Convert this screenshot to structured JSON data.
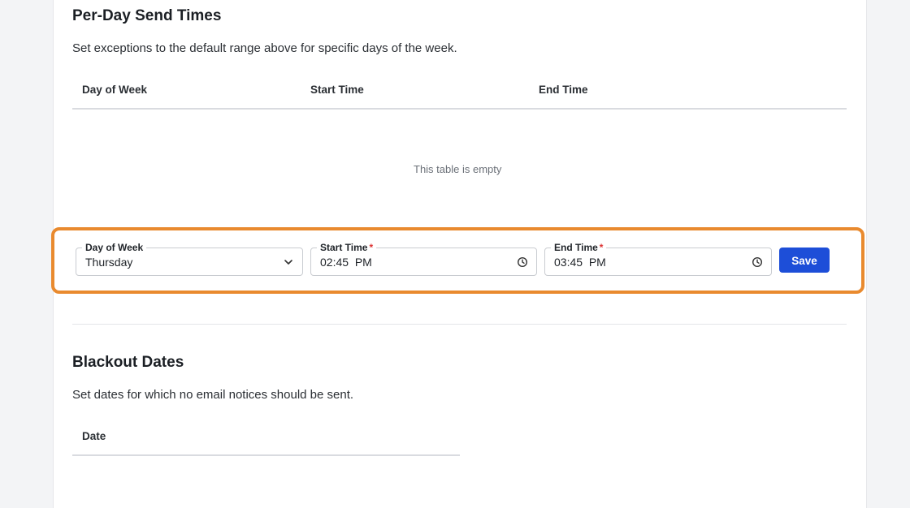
{
  "per_day": {
    "title": "Per-Day Send Times",
    "description": "Set exceptions to the default range above for specific days of the week.",
    "columns": [
      "Day of Week",
      "Start Time",
      "End Time"
    ],
    "empty_message": "This table is empty"
  },
  "form": {
    "day_label": "Day of Week",
    "day_value": "Thursday",
    "start_label": "Start Time",
    "start_value": "02:45  PM",
    "end_label": "End Time",
    "end_value": "03:45  PM",
    "required_marker": "*",
    "save_label": "Save"
  },
  "blackout": {
    "title": "Blackout Dates",
    "description": "Set dates for which no email notices should be sent.",
    "columns": [
      "Date"
    ]
  },
  "colors": {
    "highlight": "#e98a2e",
    "primary": "#1d4ed8"
  }
}
